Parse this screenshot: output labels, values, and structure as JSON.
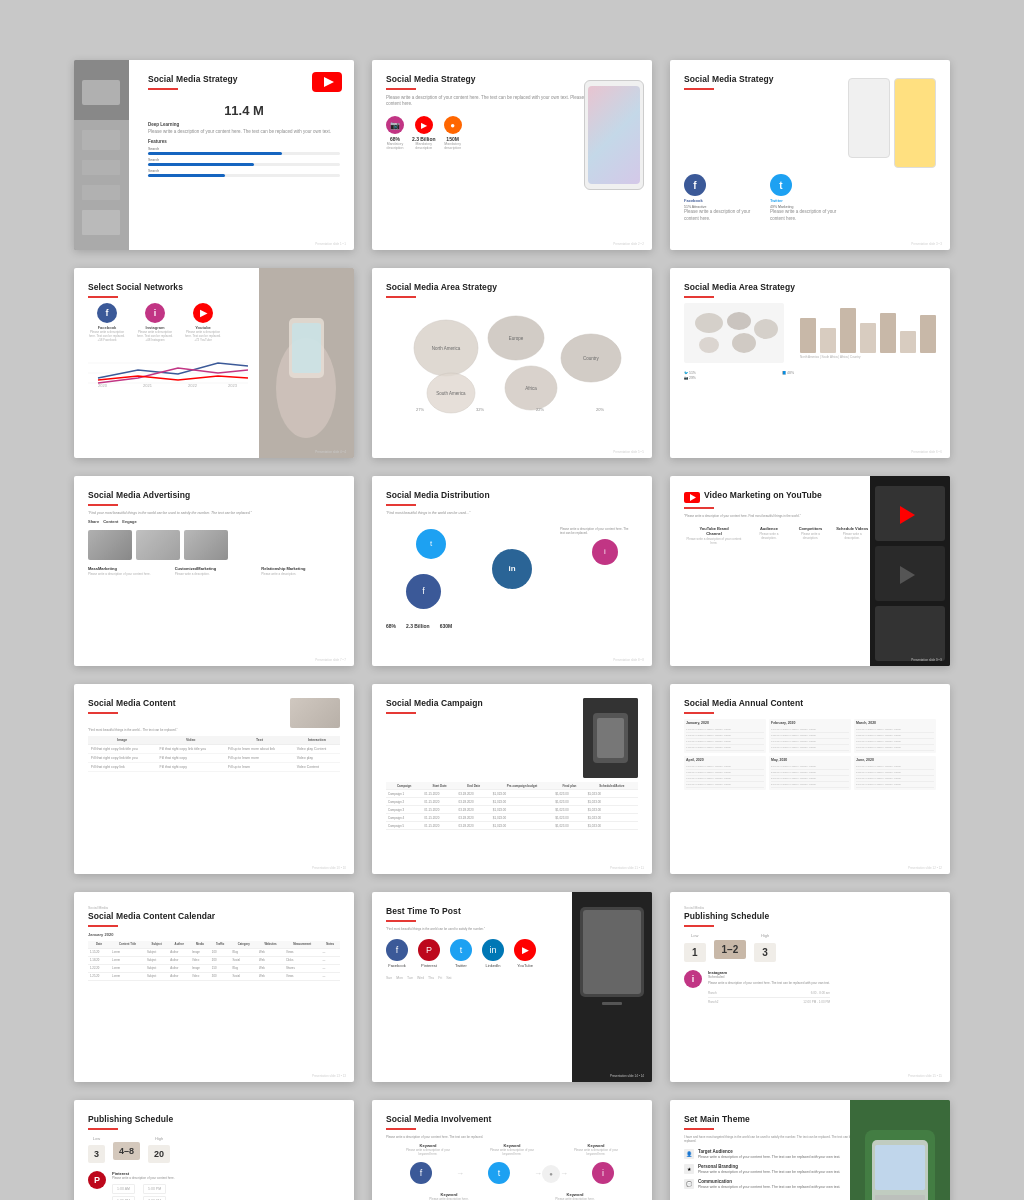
{
  "slides": [
    {
      "id": 1,
      "title": "Social Media Strategy",
      "subtitle": "YouTube",
      "big_number": "11.4 M",
      "section": "Deep Learning",
      "desc": "Please write a description of your content here. The text can be replaced with your own text.",
      "features": "Features",
      "progress_items": [
        {
          "label": "Search",
          "value": 70
        },
        {
          "label": "Search",
          "value": 55
        },
        {
          "label": "Search",
          "value": 40
        }
      ]
    },
    {
      "id": 2,
      "title": "Social Media Strategy",
      "stats": [
        {
          "icon": "📷",
          "color": "#c13584",
          "value": "68%",
          "label": "Mandatory description"
        },
        {
          "icon": "in",
          "color": "#0077b5",
          "value": "2.3 Billion",
          "label": "Mandatory description"
        },
        {
          "icon": "▶",
          "color": "#ff0000",
          "value": "150M",
          "label": "Mandatory description"
        }
      ]
    },
    {
      "id": 3,
      "title": "Social Media Strategy",
      "platforms": [
        {
          "name": "Facebook",
          "color": "#3b5998",
          "letter": "f",
          "pct": "51% Attractive"
        },
        {
          "name": "Twitter",
          "color": "#1da1f2",
          "letter": "t",
          "pct": "49% Marketing"
        }
      ],
      "desc": "Please write a description of your content here."
    },
    {
      "id": 4,
      "title": "Select Social Networks",
      "networks": [
        {
          "name": "Facebook",
          "color": "#3b5998",
          "letter": "f"
        },
        {
          "name": "Instagram",
          "color": "#c13584",
          "letter": "i"
        },
        {
          "name": "Youtube",
          "color": "#ff0000",
          "letter": "▶"
        }
      ],
      "chart_labels": [
        "2020",
        "2021",
        "2022",
        "2023"
      ]
    },
    {
      "id": 5,
      "title": "Social Media Area Strategy",
      "regions": [
        {
          "name": "North America",
          "size": 40
        },
        {
          "name": "Europe",
          "size": 35
        },
        {
          "name": "South America",
          "size": 30
        },
        {
          "name": "Africa",
          "size": 32
        },
        {
          "name": "Country",
          "size": 28
        }
      ],
      "percentages": [
        "27%",
        "32%",
        "22%",
        "20%"
      ]
    },
    {
      "id": 6,
      "title": "Social Media Area Strategy",
      "map_regions": [
        "North America",
        "South Africa",
        "Africa",
        "Country"
      ],
      "bar_values": [
        60,
        40,
        80,
        55,
        70,
        45,
        65
      ],
      "percentages": [
        "51%",
        "48%",
        "29%"
      ]
    },
    {
      "id": 7,
      "title": "Social Media Advertising",
      "subtitle_quote": "\"Find your most beautiful things in the world can be used to satisfy the number. The text can be replaced.\"",
      "categories": [
        "Share",
        "Content",
        "Engage"
      ],
      "types": [
        {
          "name": "MassMarketing",
          "desc": "Please write a description of your content here."
        },
        {
          "name": "CustomizedMarketing",
          "desc": "Please write a description."
        },
        {
          "name": "Relationship Marketing",
          "desc": "Please write a description."
        }
      ]
    },
    {
      "id": 8,
      "title": "Social Media Distribution",
      "quote": "\"Find most beautiful things in the world can be used to satisfy the number. The text can be replaced.\"",
      "stats": [
        "68%",
        "2.3 Billion",
        "630M"
      ],
      "circles": [
        {
          "color": "#2a6496",
          "size": 38,
          "letter": "in"
        },
        {
          "color": "#1da1f2",
          "size": 30,
          "letter": "t"
        },
        {
          "color": "#3b5998",
          "size": 34,
          "letter": "f"
        },
        {
          "color": "#c13584",
          "size": 26,
          "letter": "i"
        }
      ]
    },
    {
      "id": 9,
      "title": "Video Marketing on YouTube",
      "metrics": [
        {
          "label": "YouTube Brand Channel",
          "desc": "Please write a description of your content here."
        },
        {
          "label": "Audience",
          "desc": "Please write a description."
        },
        {
          "label": "Competitors",
          "desc": "Please write a description."
        },
        {
          "label": "Schedule Videos",
          "desc": "Please write a description."
        }
      ]
    },
    {
      "id": 10,
      "title": "Social Media Content",
      "columns": [
        "Image",
        "Video",
        "Text",
        "Interaction"
      ],
      "rows": [
        [
          "Fill that right copy link title you",
          "Fill that right copy link title you",
          "Fill up to learn more about link title",
          "Video play Content"
        ],
        [
          "Fill that right copy link title you",
          "Fill that right copy link title you",
          "Fill up to learn more",
          "Video play Content"
        ],
        [
          "Fill that right copy link title you",
          "Fill that right copy link title you",
          "Fill up to learn more",
          "Video play Content"
        ]
      ]
    },
    {
      "id": 11,
      "title": "Social Media Campaign",
      "columns": [
        "Campaign",
        "Start Date",
        "End Date",
        "Pre-campaign budget",
        "Final plan",
        "Scheduled/Active budget/Media"
      ],
      "rows": [
        [
          "Campaign 1",
          "01.15.2020",
          "03.28.2020",
          "$1,023.00",
          "$1,023.00",
          "$1,023.00"
        ],
        [
          "Campaign 2",
          "01.15.2020",
          "03.28.2020",
          "$1,023.00",
          "$1,023.00",
          "$1,023.00"
        ],
        [
          "Campaign 3",
          "01.15.2020",
          "03.28.2020",
          "$1,023.00",
          "$1,023.00",
          "$1,023.00"
        ],
        [
          "Campaign 4",
          "01.15.2020",
          "03.28.2020",
          "$1,023.00",
          "$1,023.00",
          "$1,023.00"
        ],
        [
          "Campaign 5",
          "01.15.2020",
          "03.28.2020",
          "$1,023.00",
          "$1,023.00",
          "$1,023.00"
        ]
      ]
    },
    {
      "id": 12,
      "title": "Social Media Annual Content",
      "months": [
        {
          "name": "January, 2020",
          "rows": [
            "1.15.20",
            "1.18.20",
            "1.22.20",
            "1.25.20"
          ]
        },
        {
          "name": "February, 2020",
          "rows": [
            "2.01.20",
            "2.05.20",
            "2.12.20",
            "2.18.20"
          ]
        },
        {
          "name": "March, 2020",
          "rows": [
            "3.01.20",
            "3.08.20",
            "3.15.20",
            "3.22.20"
          ]
        },
        {
          "name": "April, 2020",
          "rows": [
            "4.01.20",
            "4.08.20",
            "4.15.20",
            "4.22.20"
          ]
        },
        {
          "name": "May, 2020",
          "rows": [
            "5.01.20",
            "5.08.20",
            "5.15.20",
            "5.22.20"
          ]
        },
        {
          "name": "June, 2020",
          "rows": [
            "6.01.20",
            "6.08.20",
            "6.15.20",
            "6.22.20"
          ]
        }
      ]
    },
    {
      "id": 13,
      "title": "Social Media Content Calendar",
      "subtitle": "January 2020",
      "columns": [
        "Date",
        "Content Title",
        "Subject",
        "Author",
        "Media: Image / Video",
        "Traffic",
        "Category",
        "Websites",
        "Measurement",
        "Notes"
      ],
      "rows": [
        [
          "1.15.20",
          "Lorem Ipsum",
          "Subject 1",
          "Author 1",
          "Image/Video",
          "Traffic 1",
          "Category 1",
          "Website 1",
          "Measurement 1",
          "Notes"
        ],
        [
          "1.18.20",
          "Lorem Ipsum",
          "Subject 2",
          "Author 2",
          "Image/Video",
          "Traffic 2",
          "Category 2",
          "Website 2",
          "Measurement 2",
          "Notes"
        ],
        [
          "1.22.20",
          "Lorem Ipsum",
          "Subject 3",
          "Author 3",
          "Image/Video",
          "Traffic 3",
          "Category 3",
          "Website 3",
          "Measurement 3",
          "Notes"
        ],
        [
          "1.25.20",
          "Lorem Ipsum",
          "Subject 4",
          "Author 4",
          "Image/Video",
          "Traffic 4",
          "Category 4",
          "Website 4",
          "Measurement 4",
          "Notes"
        ]
      ]
    },
    {
      "id": 14,
      "title": "Best Time To Post",
      "quote": "\"Find most beautiful things in the world can be used to satisfy the number. The text can be replaced.\"",
      "platforms": [
        {
          "name": "Facebook",
          "color": "#3b5998",
          "letter": "f"
        },
        {
          "name": "Pinterest",
          "color": "#bd081c",
          "letter": "P"
        },
        {
          "name": "Twitter",
          "color": "#1da1f2",
          "letter": "t"
        },
        {
          "name": "LinkedIn",
          "color": "#0077b5",
          "letter": "in"
        },
        {
          "name": "YouTube",
          "color": "#ff0000",
          "letter": "▶"
        }
      ],
      "days": [
        "Sun",
        "Mon",
        "Tue",
        "Wed",
        "Thu",
        "Fri",
        "Sat"
      ]
    },
    {
      "id": 15,
      "title": "Publishing Schedule",
      "low": "Low",
      "mid": "1–2",
      "high": "High",
      "numbers": [
        "1",
        "1–2",
        "3"
      ],
      "platform": "Instagram",
      "sub_label": "Scheduled",
      "schedule_rows": [
        {
          "day": "Ranch",
          "time": "6:00 - 8:00 am"
        },
        {
          "day": "Ranch2",
          "time": "12:00 PM - 1:00 PM"
        }
      ]
    },
    {
      "id": 16,
      "title": "Publishing Schedule",
      "platform": "Pinterest",
      "numbers": [
        "3",
        "4–8",
        "20"
      ],
      "low": "Low",
      "mid": "4–8",
      "high": "High",
      "schedule_rows": [
        {
          "time": "1:00 AM"
        },
        {
          "time": "1:00 PM"
        },
        {
          "time": "5:00 PM"
        },
        {
          "time": "3:00 AM"
        }
      ]
    },
    {
      "id": 17,
      "title": "Social Media Involvement",
      "platforms": [
        {
          "name": "Facebook",
          "color": "#3b5998",
          "letter": "f"
        },
        {
          "name": "Twitter",
          "color": "#1da1f2",
          "letter": "t"
        },
        {
          "name": "Instagram",
          "color": "#c13584",
          "letter": "i"
        }
      ],
      "keywords": [
        "Keyword",
        "Keyword",
        "Keyword",
        "Keyword",
        "Keyword"
      ]
    },
    {
      "id": 18,
      "title": "Set Main Theme",
      "items": [
        {
          "icon": "👤",
          "title": "Target Audience",
          "desc": "Please write a description of your content here. The text can be replaced with your own text."
        },
        {
          "icon": "★",
          "title": "Personal Branding",
          "desc": "Please write a description of your content here. The text can be replaced with your own text."
        },
        {
          "icon": "💬",
          "title": "Communication",
          "desc": "Please write a description of your content here. The text can be replaced with your own text."
        }
      ]
    }
  ]
}
